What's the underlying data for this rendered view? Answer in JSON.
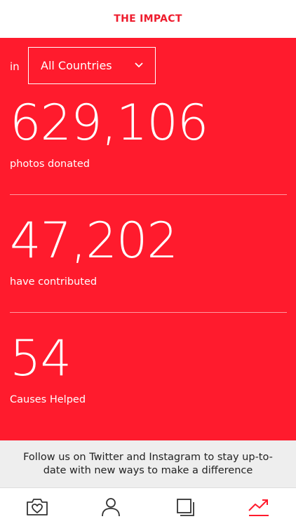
{
  "header": {
    "title": "THE IMPACT"
  },
  "filter": {
    "prefix": "in",
    "selected_country": "All Countries"
  },
  "stats": [
    {
      "value": "629,106",
      "label": "photos donated"
    },
    {
      "value": "47,202",
      "label": "have contributed"
    },
    {
      "value": "54",
      "label": "Causes Helped"
    }
  ],
  "footer": {
    "text": "Follow us on Twitter and Instagram to stay up-to-date with new ways to make a difference"
  },
  "tabbar": {
    "tabs": [
      {
        "icon": "heart-camera-icon",
        "active": false
      },
      {
        "icon": "person-icon",
        "active": false
      },
      {
        "icon": "stacked-squares-icon",
        "active": false
      },
      {
        "icon": "trend-up-icon",
        "active": true
      }
    ]
  },
  "colors": {
    "accent": "#ff1b2d",
    "title": "#ee1c2d",
    "footer_bg": "#eeeeee",
    "icon": "#333333"
  }
}
